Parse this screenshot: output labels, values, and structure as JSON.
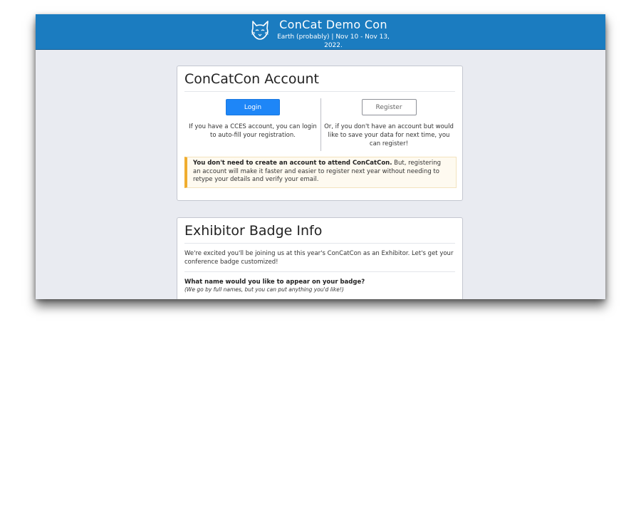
{
  "header": {
    "title": "ConCat Demo Con",
    "subtitle": "Earth (probably) | Nov 10 - Nov 13, 2022.",
    "logo_icon": "cat-head-logo-icon"
  },
  "account_card": {
    "title": "ConCatCon Account",
    "login_label": "Login",
    "login_text": "If you have a CCES account, you can login to auto-fill your registration.",
    "register_label": "Register",
    "register_text": "Or, if you don't have an account but would like to save your data for next time, you can register!",
    "notice_bold": "You don't need to create an account to attend ConCatCon.",
    "notice_text": " But, registering an account will make it faster and easier to register next year without needing to retype your details and verify your email."
  },
  "badge_card": {
    "title": "Exhibitor Badge Info",
    "intro": "We're excited you'll be joining us at this year's ConCatCon as an Exhibitor. Let's get your conference badge customized!",
    "question": "What name would you like to appear on your badge?",
    "hint": "(We go by full names, but you can put anything you'd like!)"
  },
  "colors": {
    "header_bg": "#1b7cc0",
    "primary_button": "#1e86f7",
    "notice_accent": "#f0ad2f",
    "page_bg": "#e9ebf1"
  }
}
